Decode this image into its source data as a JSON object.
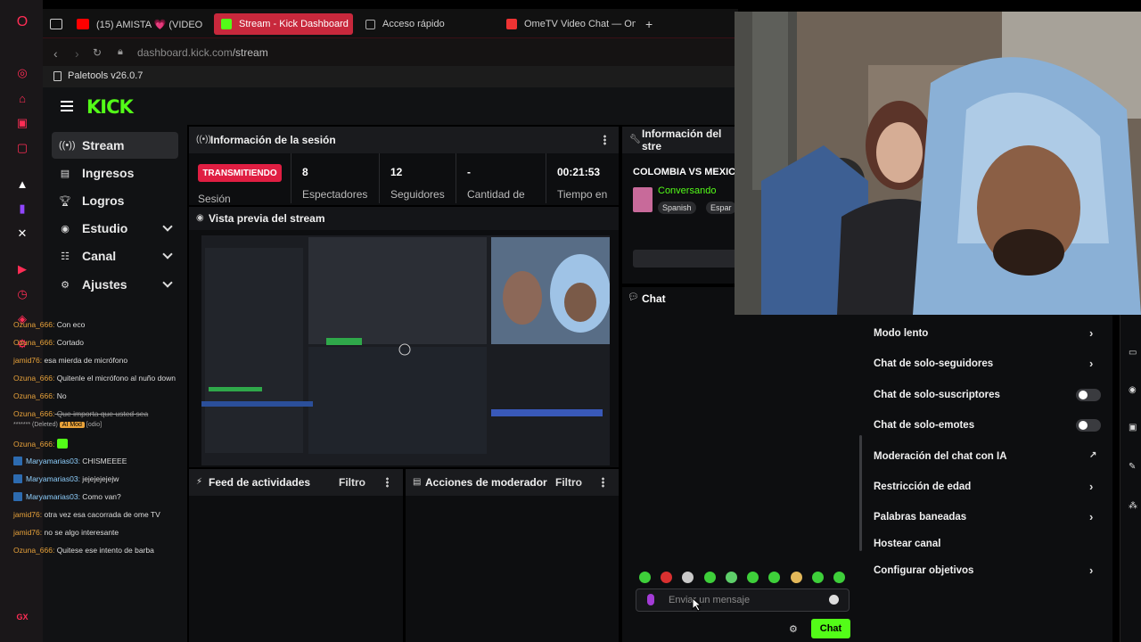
{
  "browser": {
    "tabs": [
      {
        "label": "(15) AMISTA 💗 (VIDEO C"
      },
      {
        "label": "Stream - Kick Dashboard"
      },
      {
        "label": "Acceso rápido"
      },
      {
        "label": "OmeTV Video Chat — Om"
      }
    ],
    "new_tab": "+",
    "url_host": "dashboard.kick.com",
    "url_path": "/stream",
    "bookmark": "Paletools v26.0.7"
  },
  "kick": {
    "logo": "KICK",
    "nav": [
      {
        "label": "Stream",
        "icon": "broadcast-icon"
      },
      {
        "label": "Ingresos",
        "icon": "money-icon"
      },
      {
        "label": "Logros",
        "icon": "trophy-icon"
      },
      {
        "label": "Estudio",
        "icon": "studio-icon"
      },
      {
        "label": "Canal",
        "icon": "channel-icon"
      },
      {
        "label": "Ajustes",
        "icon": "gear-icon"
      }
    ],
    "session": {
      "title": "Información de la sesión",
      "live_badge": "TRANSMITIENDO",
      "stats": [
        {
          "value": "8",
          "label": "Espectadores"
        },
        {
          "value": "12",
          "label": "Seguidores"
        },
        {
          "value": "-",
          "label": "Cantidad de"
        },
        {
          "value": "00:21:53",
          "label": "Tiempo en"
        }
      ],
      "session_label": "Sesión"
    },
    "preview_title": "Vista previa del stream",
    "feed": {
      "title": "Feed de actividades",
      "filter": "Filtro"
    },
    "mod": {
      "title": "Acciones de moderador",
      "filter": "Filtro"
    },
    "stream_info": {
      "title": "Información del stre",
      "stream_title": "COLOMBIA VS MEXIC",
      "category": "Conversando",
      "tags": [
        "Spanish",
        "Espar"
      ]
    },
    "chat": {
      "title": "Chat",
      "messages": [
        {
          "user": "Ozuna_666:",
          "text": " Con eco"
        },
        {
          "user": "Ozuna_666:",
          "text": " Cortado"
        },
        {
          "user": "jamid76:",
          "text": " esa mierda de micrófono"
        },
        {
          "user": "Ozuna_666:",
          "text": " Quitenle el micrófono al nuño down"
        },
        {
          "user": "Ozuna_666:",
          "text": " No"
        },
        {
          "user": "Ozuna_666:",
          "text": " Que importa que usted sea"
        },
        {
          "user": "Ozuna_666:",
          "text": ""
        },
        {
          "user": "Maryamarias03:",
          "text": " CHISMEEEE"
        },
        {
          "user": "Maryamarias03:",
          "text": " jejejejejejw"
        },
        {
          "user": "Maryamarias03:",
          "text": " Como van?"
        },
        {
          "user": "jamid76:",
          "text": " otra vez esa cacorrada de ome TV"
        },
        {
          "user": "jamid76:",
          "text": " no se algo interesante"
        },
        {
          "user": "Ozuna_666:",
          "text": " Quitese ese intento de barba"
        }
      ],
      "deleted_line": "******* (Deleted)",
      "deleted_tag": "AI Mod",
      "deleted_extra": "[odio]",
      "placeholder": "Enviar un mensaje",
      "send_label": "Chat"
    },
    "settings": [
      {
        "label": "Modo lento",
        "control": "arrow"
      },
      {
        "label": "Chat de solo-seguidores",
        "control": "arrow"
      },
      {
        "label": "Chat de solo-suscriptores",
        "control": "toggle"
      },
      {
        "label": "Chat de solo-emotes",
        "control": "toggle"
      },
      {
        "label": "Moderación del chat con IA",
        "control": "external"
      },
      {
        "label": "Restricción de edad",
        "control": "arrow"
      },
      {
        "label": "Palabras baneadas",
        "control": "arrow"
      },
      {
        "label": "Hostear canal",
        "control": "none"
      },
      {
        "label": "Configurar objetivos",
        "control": "arrow"
      }
    ]
  },
  "colors": {
    "kick_green": "#53fc18",
    "live_red": "#e01e42",
    "tab_active": "#c8283c"
  }
}
